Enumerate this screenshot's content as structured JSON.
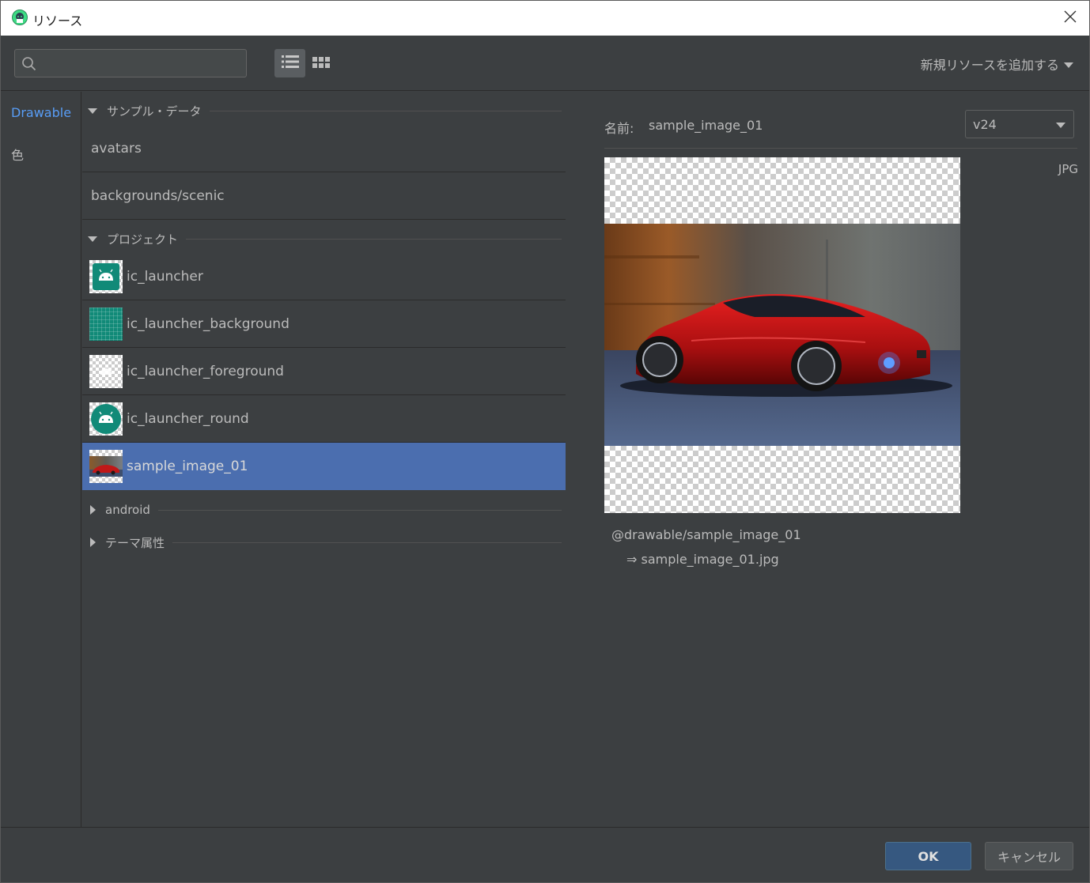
{
  "window": {
    "title": "リソース",
    "app_icon": "android-studio-icon",
    "close_icon": "close-icon"
  },
  "toolbar": {
    "search_placeholder": "",
    "search_value": "",
    "add_resource_label": "新規リソースを追加する"
  },
  "categories": [
    {
      "label": "Drawable",
      "active": true
    },
    {
      "label": "色",
      "active": false
    }
  ],
  "sections": {
    "sample_data": {
      "label": "サンプル・データ",
      "items": [
        "avatars",
        "backgrounds/scenic"
      ]
    },
    "project": {
      "label": "プロジェクト",
      "items": [
        "ic_launcher",
        "ic_launcher_background",
        "ic_launcher_foreground",
        "ic_launcher_round",
        "sample_image_01"
      ],
      "selected": "sample_image_01"
    },
    "android": {
      "label": "android"
    },
    "theme_attrs": {
      "label": "テーマ属性"
    }
  },
  "detail": {
    "name_label": "名前:",
    "name_value": "sample_image_01",
    "version": "v24",
    "format": "JPG",
    "reference": "@drawable/sample_image_01",
    "file": "⇒ sample_image_01.jpg"
  },
  "footer": {
    "ok_label": "OK",
    "cancel_label": "キャンセル"
  },
  "colors": {
    "background": "#3c3f41",
    "selection": "#4b6eaf",
    "accent": "#589df6",
    "ok_button": "#365880"
  }
}
